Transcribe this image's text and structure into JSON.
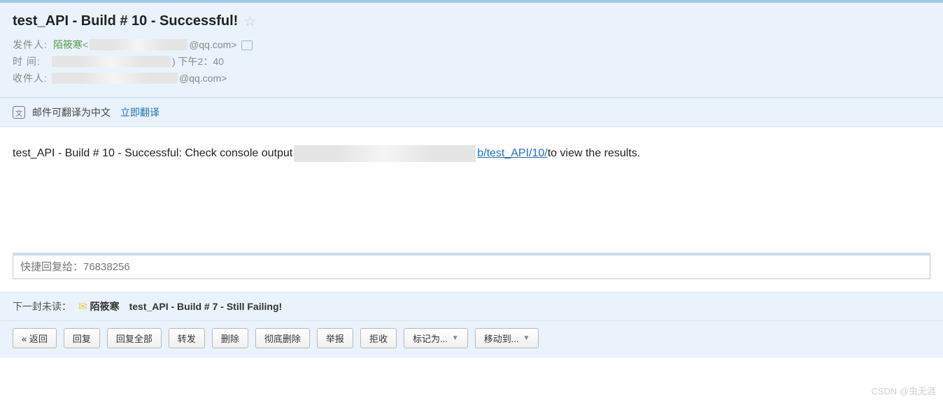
{
  "email": {
    "subject": "test_API - Build # 10 - Successful!",
    "sender_label": "发件人:",
    "sender_name": "陌筱寒",
    "sender_bracket_open": " < ",
    "sender_email_suffix": "@qq.com>",
    "time_label": "时   间:",
    "time_suffix": ") 下午2：40",
    "recipient_label": "收件人:",
    "recipient_suffix": "@qq.com>"
  },
  "translate": {
    "message": "邮件可翻译为中文",
    "link": "立即翻译"
  },
  "body": {
    "text_before": "test_API - Build # 10 - Successful: Check console output ",
    "link_text": "b/test_API/10/",
    "text_after": " to view the results."
  },
  "quick_reply": {
    "placeholder": "快捷回复给：76838256"
  },
  "next_unread": {
    "label": "下一封未读：",
    "sender": "陌筱寒",
    "subject": "test_API - Build # 7 - Still Failing!"
  },
  "actions": {
    "back": "« 返回",
    "reply": "回复",
    "reply_all": "回复全部",
    "forward": "转发",
    "delete": "删除",
    "delete_forever": "彻底删除",
    "report": "举报",
    "reject": "拒收",
    "mark_as": "标记为...",
    "move_to": "移动到..."
  },
  "watermark": "CSDN @虫无涯"
}
